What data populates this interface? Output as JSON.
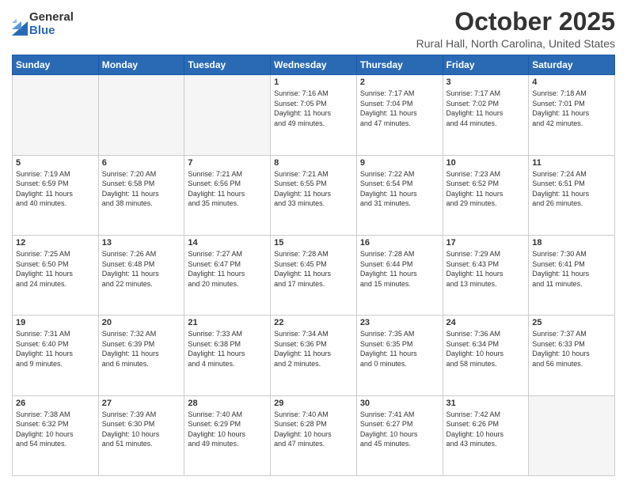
{
  "logo": {
    "general": "General",
    "blue": "Blue"
  },
  "title": "October 2025",
  "location": "Rural Hall, North Carolina, United States",
  "days_of_week": [
    "Sunday",
    "Monday",
    "Tuesday",
    "Wednesday",
    "Thursday",
    "Friday",
    "Saturday"
  ],
  "weeks": [
    [
      {
        "day": "",
        "info": ""
      },
      {
        "day": "",
        "info": ""
      },
      {
        "day": "",
        "info": ""
      },
      {
        "day": "1",
        "info": "Sunrise: 7:16 AM\nSunset: 7:05 PM\nDaylight: 11 hours\nand 49 minutes."
      },
      {
        "day": "2",
        "info": "Sunrise: 7:17 AM\nSunset: 7:04 PM\nDaylight: 11 hours\nand 47 minutes."
      },
      {
        "day": "3",
        "info": "Sunrise: 7:17 AM\nSunset: 7:02 PM\nDaylight: 11 hours\nand 44 minutes."
      },
      {
        "day": "4",
        "info": "Sunrise: 7:18 AM\nSunset: 7:01 PM\nDaylight: 11 hours\nand 42 minutes."
      }
    ],
    [
      {
        "day": "5",
        "info": "Sunrise: 7:19 AM\nSunset: 6:59 PM\nDaylight: 11 hours\nand 40 minutes."
      },
      {
        "day": "6",
        "info": "Sunrise: 7:20 AM\nSunset: 6:58 PM\nDaylight: 11 hours\nand 38 minutes."
      },
      {
        "day": "7",
        "info": "Sunrise: 7:21 AM\nSunset: 6:56 PM\nDaylight: 11 hours\nand 35 minutes."
      },
      {
        "day": "8",
        "info": "Sunrise: 7:21 AM\nSunset: 6:55 PM\nDaylight: 11 hours\nand 33 minutes."
      },
      {
        "day": "9",
        "info": "Sunrise: 7:22 AM\nSunset: 6:54 PM\nDaylight: 11 hours\nand 31 minutes."
      },
      {
        "day": "10",
        "info": "Sunrise: 7:23 AM\nSunset: 6:52 PM\nDaylight: 11 hours\nand 29 minutes."
      },
      {
        "day": "11",
        "info": "Sunrise: 7:24 AM\nSunset: 6:51 PM\nDaylight: 11 hours\nand 26 minutes."
      }
    ],
    [
      {
        "day": "12",
        "info": "Sunrise: 7:25 AM\nSunset: 6:50 PM\nDaylight: 11 hours\nand 24 minutes."
      },
      {
        "day": "13",
        "info": "Sunrise: 7:26 AM\nSunset: 6:48 PM\nDaylight: 11 hours\nand 22 minutes."
      },
      {
        "day": "14",
        "info": "Sunrise: 7:27 AM\nSunset: 6:47 PM\nDaylight: 11 hours\nand 20 minutes."
      },
      {
        "day": "15",
        "info": "Sunrise: 7:28 AM\nSunset: 6:45 PM\nDaylight: 11 hours\nand 17 minutes."
      },
      {
        "day": "16",
        "info": "Sunrise: 7:28 AM\nSunset: 6:44 PM\nDaylight: 11 hours\nand 15 minutes."
      },
      {
        "day": "17",
        "info": "Sunrise: 7:29 AM\nSunset: 6:43 PM\nDaylight: 11 hours\nand 13 minutes."
      },
      {
        "day": "18",
        "info": "Sunrise: 7:30 AM\nSunset: 6:41 PM\nDaylight: 11 hours\nand 11 minutes."
      }
    ],
    [
      {
        "day": "19",
        "info": "Sunrise: 7:31 AM\nSunset: 6:40 PM\nDaylight: 11 hours\nand 9 minutes."
      },
      {
        "day": "20",
        "info": "Sunrise: 7:32 AM\nSunset: 6:39 PM\nDaylight: 11 hours\nand 6 minutes."
      },
      {
        "day": "21",
        "info": "Sunrise: 7:33 AM\nSunset: 6:38 PM\nDaylight: 11 hours\nand 4 minutes."
      },
      {
        "day": "22",
        "info": "Sunrise: 7:34 AM\nSunset: 6:36 PM\nDaylight: 11 hours\nand 2 minutes."
      },
      {
        "day": "23",
        "info": "Sunrise: 7:35 AM\nSunset: 6:35 PM\nDaylight: 11 hours\nand 0 minutes."
      },
      {
        "day": "24",
        "info": "Sunrise: 7:36 AM\nSunset: 6:34 PM\nDaylight: 10 hours\nand 58 minutes."
      },
      {
        "day": "25",
        "info": "Sunrise: 7:37 AM\nSunset: 6:33 PM\nDaylight: 10 hours\nand 56 minutes."
      }
    ],
    [
      {
        "day": "26",
        "info": "Sunrise: 7:38 AM\nSunset: 6:32 PM\nDaylight: 10 hours\nand 54 minutes."
      },
      {
        "day": "27",
        "info": "Sunrise: 7:39 AM\nSunset: 6:30 PM\nDaylight: 10 hours\nand 51 minutes."
      },
      {
        "day": "28",
        "info": "Sunrise: 7:40 AM\nSunset: 6:29 PM\nDaylight: 10 hours\nand 49 minutes."
      },
      {
        "day": "29",
        "info": "Sunrise: 7:40 AM\nSunset: 6:28 PM\nDaylight: 10 hours\nand 47 minutes."
      },
      {
        "day": "30",
        "info": "Sunrise: 7:41 AM\nSunset: 6:27 PM\nDaylight: 10 hours\nand 45 minutes."
      },
      {
        "day": "31",
        "info": "Sunrise: 7:42 AM\nSunset: 6:26 PM\nDaylight: 10 hours\nand 43 minutes."
      },
      {
        "day": "",
        "info": ""
      }
    ]
  ]
}
